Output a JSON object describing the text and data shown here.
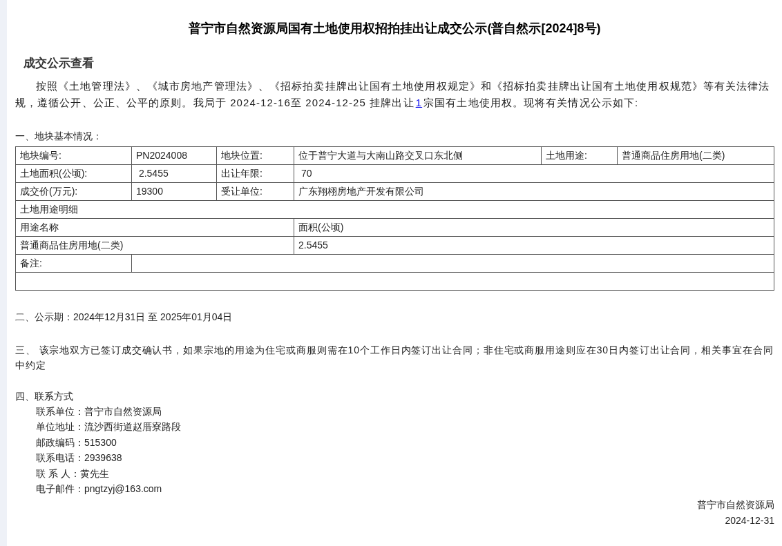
{
  "title": "普宁市自然资源局国有土地使用权招拍挂出让成交公示(普自然示[2024]8号)",
  "section_heading": "成交公示查看",
  "intro": {
    "before": "按照《土地管理法》、《城市房地产管理法》、《招标拍卖挂牌出让国有土地使用权规定》和《招标拍卖挂牌出让国有土地使用权规范》等有关法律法规，遵循公开、公正、公平的原则。我局于 2024-12-16至 2024-12-25 挂牌出让",
    "link": "1",
    "after": "宗国有土地使用权。现将有关情况公示如下:"
  },
  "basic_heading": "一、地块基本情况：",
  "table": {
    "rows": [
      [
        {
          "label": "地块编号:",
          "value": "PN2024008"
        },
        {
          "label": "地块位置:",
          "value": "位于普宁大道与大南山路交叉口东北侧"
        },
        {
          "label": "土地用途:",
          "value": "普通商品住房用地(二类)"
        }
      ],
      [
        {
          "label": "土地面积(公顷):",
          "value": " 2.5455"
        },
        {
          "label": "出让年限:",
          "value": " 70"
        }
      ],
      [
        {
          "label": "成交价(万元):",
          "value": "19300"
        },
        {
          "label": "受让单位:",
          "value": "广东翔栩房地产开发有限公司"
        }
      ]
    ],
    "detail_title": "土地用途明细",
    "detail_columns": [
      "用途名称",
      "面积(公顷)"
    ],
    "detail_rows": [
      [
        "普通商品住房用地(二类)",
        "2.5455"
      ]
    ],
    "remark_label": "备注:"
  },
  "period": "二、公示期：2024年12月31日 至 2025年01月04日",
  "notice": "三、 该宗地双方已签订成交确认书，如果宗地的用途为住宅或商服则需在10个工作日内签订出让合同；非住宅或商服用途则应在30日内签订出让合同，相关事宜在合同中约定",
  "contact_heading": "四、联系方式",
  "contacts": [
    "联系单位：普宁市自然资源局",
    "单位地址：流沙西街道赵厝寮路段",
    "邮政编码：515300",
    "联系电话：2939638",
    "联 系 人：黄先生",
    "电子邮件：pngtzyj@163.com"
  ],
  "signature": [
    "普宁市自然资源局",
    "2024-12-31"
  ]
}
